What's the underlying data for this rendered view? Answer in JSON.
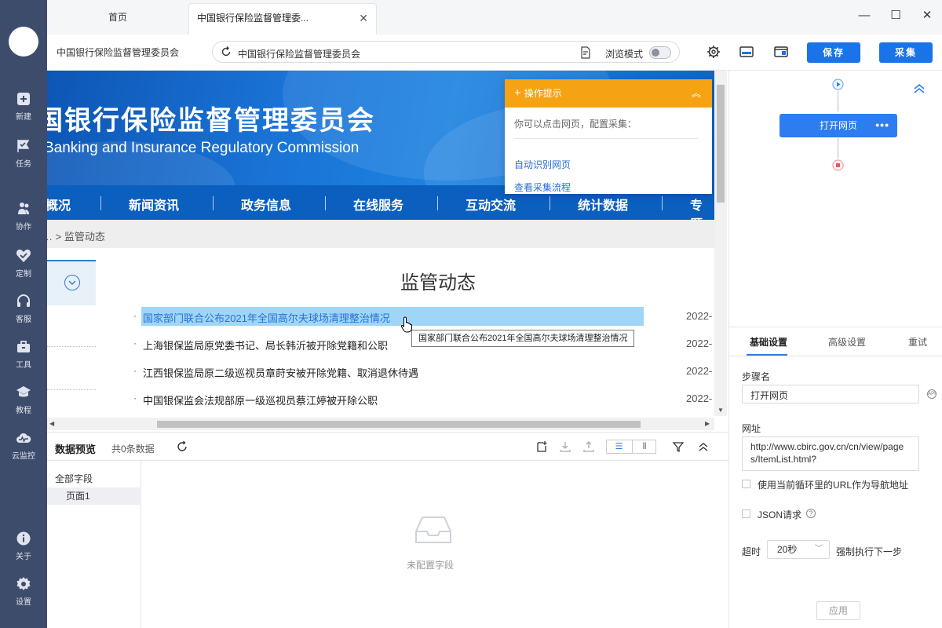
{
  "sidebar": {
    "items": [
      {
        "label": "新建",
        "icon": "plus-square-icon"
      },
      {
        "label": "任务",
        "icon": "task-flag-icon"
      },
      {
        "label": "协作",
        "icon": "users-icon"
      },
      {
        "label": "定制",
        "icon": "heart-check-icon"
      },
      {
        "label": "客服",
        "icon": "headset-icon"
      },
      {
        "label": "工具",
        "icon": "toolbox-icon"
      },
      {
        "label": "教程",
        "icon": "graduation-cap-icon"
      },
      {
        "label": "云监控",
        "icon": "cloud-monitor-icon"
      }
    ],
    "bottom_items": [
      {
        "label": "关于",
        "icon": "info-icon"
      },
      {
        "label": "设置",
        "icon": "gear-icon"
      }
    ]
  },
  "tabs": {
    "home": "首页",
    "active": "中国银行保险监督管理委..."
  },
  "toolbar": {
    "page_name": "中国银行保险监督管理委员会",
    "url_text": "中国银行保险监督管理委员会",
    "browse_mode": "浏览模式",
    "save": "保存",
    "collect": "采集"
  },
  "webpage": {
    "banner_cn": "国银行保险监督管理委员会",
    "banner_en": "Banking and Insurance Regulatory Commission",
    "nav": [
      "概况",
      "新闻资讯",
      "政务信息",
      "在线服务",
      "互动交流",
      "统计数据",
      "专题"
    ],
    "breadcrumb": "… > 监管动态",
    "section_title": "监管动态",
    "news": [
      {
        "title": "国家部门联合公布2021年全国高尔夫球场清理整治情况",
        "date": "2022-"
      },
      {
        "title": "上海银保监局原党委书记、局长韩沂被开除党籍和公职",
        "date": "2022-"
      },
      {
        "title": "江西银保监局原二级巡视员章莳安被开除党籍、取消退休待遇",
        "date": "2022-"
      },
      {
        "title": "中国银保监会法规部原一级巡视员蔡江婷被开除公职",
        "date": "2022-"
      }
    ],
    "tooltip": "国家部门联合公布2021年全国高尔夫球场清理整治情况"
  },
  "hint": {
    "title": "操作提示",
    "body": "你可以点击网页，配置采集：",
    "links": [
      "自动识别网页",
      "查看采集流程"
    ]
  },
  "preview": {
    "title": "数据预览",
    "count": "共0条数据",
    "field_all": "全部字段",
    "field_page": "页面1",
    "empty": "未配置字段"
  },
  "flow": {
    "step_label": "打开网页",
    "step_more": "•••"
  },
  "settings": {
    "tabs": [
      "基础设置",
      "高级设置",
      "重试"
    ],
    "step_name_label": "步骤名",
    "step_name_value": "打开网页",
    "url_label": "网址",
    "url_value": "http://www.cbirc.gov.cn/cn/view/pages/ItemList.html?",
    "use_loop_url": "使用当前循环里的URL作为导航地址",
    "json_request": "JSON请求",
    "timeout_label": "超时",
    "timeout_value": "20秒",
    "force_next": "强制执行下一步",
    "apply": "应用"
  },
  "colors": {
    "sidebar": "#3e4c6c",
    "accent": "#1a73e8",
    "hint_header": "#f6a313",
    "highlight": "#9fd6f7"
  }
}
